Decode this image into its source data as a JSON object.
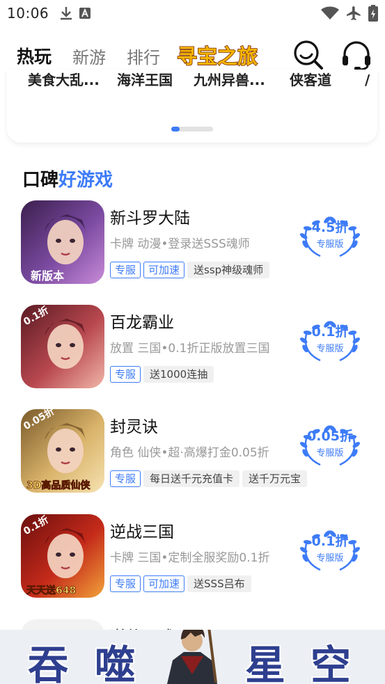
{
  "status_bar": {
    "time": "10:06"
  },
  "header": {
    "tabs": [
      {
        "label": "热玩",
        "active": true
      },
      {
        "label": "新游",
        "active": false
      },
      {
        "label": "排行",
        "active": false
      }
    ],
    "banner_text": "寻宝之旅",
    "icons": [
      "search-icon",
      "headset-icon"
    ]
  },
  "top_card": {
    "names": [
      "美食大乱...",
      "海洋王国",
      "九州异兽...",
      "侠客道",
      "/"
    ],
    "page_index": 0
  },
  "section": {
    "title_plain": "口碑",
    "title_highlight": "好游戏"
  },
  "games": [
    {
      "name": "新斗罗大陆",
      "desc": "卡牌 动漫•登录送SSS魂师",
      "tags_blue": [
        "专服",
        "可加速"
      ],
      "tags_gray": [
        "送ssp神级魂师"
      ],
      "discount": "4.5折",
      "version": "专服版",
      "thumb_label": "新版本",
      "thumb_colors": [
        "#3b1f4e",
        "#7a4aa0",
        "#c98bd8"
      ]
    },
    {
      "name": "百龙霸业",
      "desc": "放置 三国•0.1折正版放置三国",
      "tags_blue": [
        "专服"
      ],
      "tags_gray": [
        "送1000连抽"
      ],
      "discount": "0.1折",
      "version": "专服版",
      "thumb_label": "0.1折",
      "thumb_colors": [
        "#5a1a22",
        "#b8484f",
        "#f1b6a8"
      ]
    },
    {
      "name": "封灵诀",
      "desc": "角色 仙侠•超·高爆打金0.05折",
      "tags_blue": [
        "专服"
      ],
      "tags_gray": [
        "每日送千元充值卡",
        "送千万元宝"
      ],
      "discount": "0.05折",
      "version": "专服版",
      "thumb_label": "0.05折",
      "thumb_sub": "3D高品质仙侠",
      "thumb_colors": [
        "#7a5a2a",
        "#d9b36a",
        "#f6e2b0"
      ]
    },
    {
      "name": "逆战三国",
      "desc": "卡牌 三国•定制全服奖励0.1折",
      "tags_blue": [
        "专服",
        "可加速"
      ],
      "tags_gray": [
        "送SSS吕布"
      ],
      "discount": "0.1折",
      "version": "专服版",
      "thumb_label": "0.1折",
      "thumb_sub": "天天送648",
      "thumb_colors": [
        "#6b0f0f",
        "#c42a1a",
        "#f2a23a"
      ]
    }
  ],
  "next_game": {
    "name": "逆仙三武"
  },
  "ad_banner": {
    "chars": [
      "吞",
      "噬",
      "星",
      "空"
    ]
  },
  "colors": {
    "accent": "#3d7bf7"
  }
}
